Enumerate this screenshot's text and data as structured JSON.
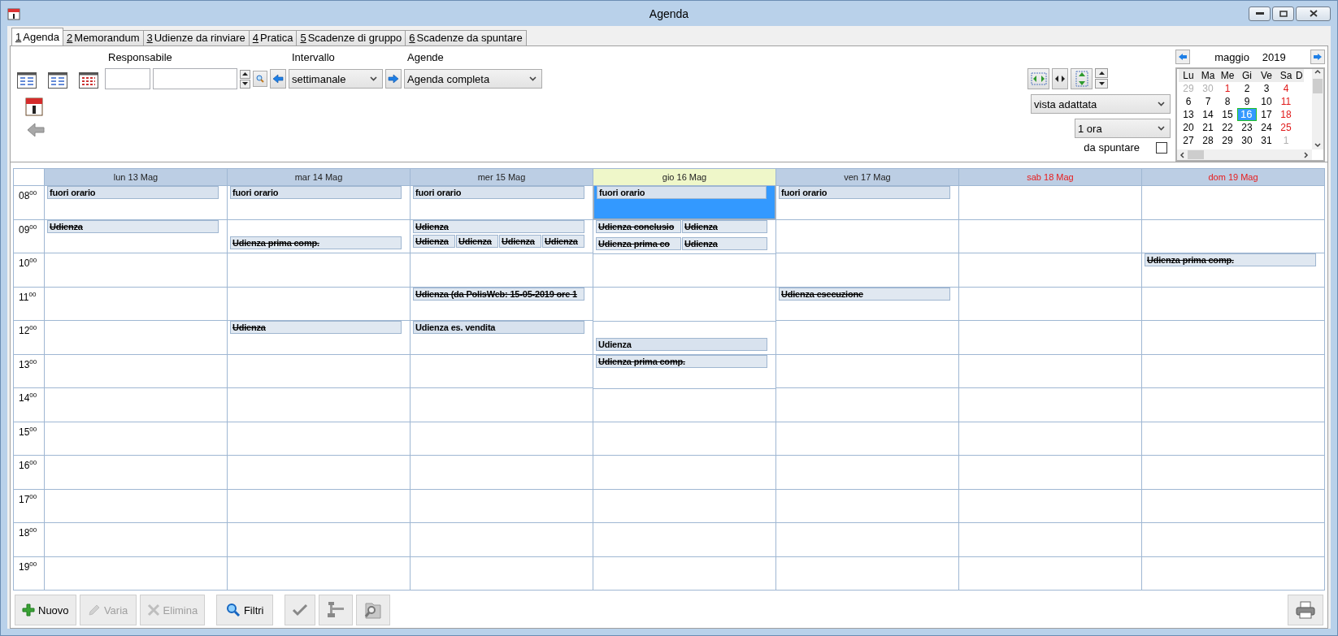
{
  "window": {
    "title": "Agenda"
  },
  "tabs": [
    {
      "key": "1",
      "label": "Agenda",
      "selected": true
    },
    {
      "key": "2",
      "label": "Memorandum",
      "selected": false
    },
    {
      "key": "3",
      "label": "Udienze da rinviare",
      "selected": false
    },
    {
      "key": "4",
      "label": "Pratica",
      "selected": false
    },
    {
      "key": "5",
      "label": "Scadenze di gruppo",
      "selected": false
    },
    {
      "key": "6",
      "label": "Scadenze da spuntare",
      "selected": false
    }
  ],
  "filters": {
    "responsabile": {
      "label": "Responsabile"
    },
    "intervallo": {
      "label": "Intervallo",
      "value": "settimanale"
    },
    "agende": {
      "label": "Agende",
      "value": "Agenda completa"
    }
  },
  "view": {
    "mode": "vista adattata",
    "step": "1 ora",
    "da_spuntare": {
      "label": "da spuntare",
      "checked": false
    }
  },
  "mini_calendar": {
    "month": "maggio",
    "year": "2019",
    "weekdays": [
      "Lu",
      "Ma",
      "Me",
      "Gi",
      "Ve",
      "Sa",
      "D"
    ],
    "weeks": [
      [
        {
          "day": "29",
          "kind": "muted",
          "selected": false
        },
        {
          "day": "30",
          "kind": "muted",
          "selected": false
        },
        {
          "day": "1",
          "kind": "red",
          "selected": false
        },
        {
          "day": "2",
          "kind": "normal",
          "selected": false
        },
        {
          "day": "3",
          "kind": "normal",
          "selected": false
        },
        {
          "day": "4",
          "kind": "red",
          "selected": false
        }
      ],
      [
        {
          "day": "6",
          "kind": "normal",
          "selected": false
        },
        {
          "day": "7",
          "kind": "normal",
          "selected": false
        },
        {
          "day": "8",
          "kind": "normal",
          "selected": false
        },
        {
          "day": "9",
          "kind": "normal",
          "selected": false
        },
        {
          "day": "10",
          "kind": "normal",
          "selected": false
        },
        {
          "day": "11",
          "kind": "red",
          "selected": false
        }
      ],
      [
        {
          "day": "13",
          "kind": "normal",
          "selected": false
        },
        {
          "day": "14",
          "kind": "normal",
          "selected": false
        },
        {
          "day": "15",
          "kind": "normal",
          "selected": false
        },
        {
          "day": "16",
          "kind": "normal",
          "selected": true
        },
        {
          "day": "17",
          "kind": "normal",
          "selected": false
        },
        {
          "day": "18",
          "kind": "red",
          "selected": false
        }
      ],
      [
        {
          "day": "20",
          "kind": "normal",
          "selected": false
        },
        {
          "day": "21",
          "kind": "normal",
          "selected": false
        },
        {
          "day": "22",
          "kind": "normal",
          "selected": false
        },
        {
          "day": "23",
          "kind": "normal",
          "selected": false
        },
        {
          "day": "24",
          "kind": "normal",
          "selected": false
        },
        {
          "day": "25",
          "kind": "red",
          "selected": false
        }
      ],
      [
        {
          "day": "27",
          "kind": "normal",
          "selected": false
        },
        {
          "day": "28",
          "kind": "normal",
          "selected": false
        },
        {
          "day": "29",
          "kind": "normal",
          "selected": false
        },
        {
          "day": "30",
          "kind": "normal",
          "selected": false
        },
        {
          "day": "31",
          "kind": "normal",
          "selected": false
        },
        {
          "day": "1",
          "kind": "muted",
          "selected": false
        }
      ]
    ]
  },
  "hours": [
    {
      "hour": "08",
      "minutes": "00"
    },
    {
      "hour": "09",
      "minutes": "00"
    },
    {
      "hour": "10",
      "minutes": "00"
    },
    {
      "hour": "11",
      "minutes": "00"
    },
    {
      "hour": "12",
      "minutes": "00"
    },
    {
      "hour": "13",
      "minutes": "00"
    },
    {
      "hour": "14",
      "minutes": "00"
    },
    {
      "hour": "15",
      "minutes": "00"
    },
    {
      "hour": "16",
      "minutes": "00"
    },
    {
      "hour": "17",
      "minutes": "00"
    },
    {
      "hour": "18",
      "minutes": "00"
    },
    {
      "hour": "19",
      "minutes": "00"
    }
  ],
  "days": [
    {
      "label": "lun 13 Mag",
      "today": false,
      "weekend": false,
      "slots": [
        {
          "selected": false,
          "top": [
            {
              "title": "fuori orario",
              "done": false
            }
          ]
        },
        {
          "selected": false,
          "top": [
            {
              "title": "Udienza",
              "done": true
            }
          ]
        },
        {
          "selected": false
        },
        {
          "selected": false
        },
        {
          "selected": false
        },
        {
          "selected": false
        },
        {
          "selected": false
        },
        {
          "selected": false
        },
        {
          "selected": false
        },
        {
          "selected": false
        },
        {
          "selected": false
        },
        {
          "selected": false
        }
      ]
    },
    {
      "label": "mar 14 Mag",
      "today": false,
      "weekend": false,
      "slots": [
        {
          "selected": false,
          "top": [
            {
              "title": "fuori orario",
              "done": false
            }
          ]
        },
        {
          "selected": false,
          "bottom": [
            {
              "title": "Udienza prima comp.",
              "done": true
            }
          ]
        },
        {
          "selected": false
        },
        {
          "selected": false
        },
        {
          "selected": false,
          "top": [
            {
              "title": "Udienza",
              "done": true
            }
          ]
        },
        {
          "selected": false
        },
        {
          "selected": false
        },
        {
          "selected": false
        },
        {
          "selected": false
        },
        {
          "selected": false
        },
        {
          "selected": false
        },
        {
          "selected": false
        }
      ]
    },
    {
      "label": "mer 15 Mag",
      "today": false,
      "weekend": false,
      "slots": [
        {
          "selected": false,
          "top": [
            {
              "title": "fuori orario",
              "done": false
            }
          ]
        },
        {
          "selected": false,
          "top": [
            {
              "title": "Udienza",
              "done": true
            }
          ],
          "bottom": [
            {
              "title": "Udienza",
              "done": true
            },
            {
              "title": "Udienza",
              "done": true
            },
            {
              "title": "Udienza",
              "done": true
            },
            {
              "title": "Udienza",
              "done": true
            }
          ]
        },
        {
          "selected": false
        },
        {
          "selected": false,
          "top": [
            {
              "title": "Udienza (da PolisWeb: 15-05-2019 ore 1",
              "done": true
            }
          ]
        },
        {
          "selected": false,
          "top": [
            {
              "title": "Udienza es. vendita",
              "done": false
            }
          ]
        },
        {
          "selected": false
        },
        {
          "selected": false
        },
        {
          "selected": false
        },
        {
          "selected": false
        },
        {
          "selected": false
        },
        {
          "selected": false
        },
        {
          "selected": false
        }
      ]
    },
    {
      "label": "gio 16 Mag",
      "today": true,
      "weekend": false,
      "slots": [
        {
          "selected": true,
          "top": [
            {
              "title": "fuori orario",
              "done": false
            }
          ]
        },
        {
          "selected": false,
          "top": [
            {
              "title": "Udienza conclusio",
              "done": true
            },
            {
              "title": "Udienza",
              "done": true
            }
          ],
          "bottom": [
            {
              "title": "Udienza prima co",
              "done": true
            },
            {
              "title": "Udienza",
              "done": true
            }
          ]
        },
        {
          "selected": false
        },
        {
          "selected": false
        },
        {
          "selected": false,
          "bottom": [
            {
              "title": "Udienza",
              "done": false
            }
          ]
        },
        {
          "selected": false,
          "top": [
            {
              "title": "Udienza prima comp.",
              "done": true
            }
          ]
        },
        {
          "selected": false
        },
        {
          "selected": false
        },
        {
          "selected": false
        },
        {
          "selected": false
        },
        {
          "selected": false
        },
        {
          "selected": false
        }
      ]
    },
    {
      "label": "ven 17 Mag",
      "today": false,
      "weekend": false,
      "slots": [
        {
          "selected": false,
          "top": [
            {
              "title": "fuori orario",
              "done": false
            }
          ]
        },
        {
          "selected": false
        },
        {
          "selected": false
        },
        {
          "selected": false,
          "top": [
            {
              "title": "Udienza esecuzione",
              "done": true
            }
          ]
        },
        {
          "selected": false
        },
        {
          "selected": false
        },
        {
          "selected": false
        },
        {
          "selected": false
        },
        {
          "selected": false
        },
        {
          "selected": false
        },
        {
          "selected": false
        },
        {
          "selected": false
        }
      ]
    },
    {
      "label": "sab 18 Mag",
      "today": false,
      "weekend": true,
      "slots": [
        {
          "selected": false
        },
        {
          "selected": false
        },
        {
          "selected": false
        },
        {
          "selected": false
        },
        {
          "selected": false
        },
        {
          "selected": false
        },
        {
          "selected": false
        },
        {
          "selected": false
        },
        {
          "selected": false
        },
        {
          "selected": false
        },
        {
          "selected": false
        },
        {
          "selected": false
        }
      ]
    },
    {
      "label": "dom 19 Mag",
      "today": false,
      "weekend": true,
      "slots": [
        {
          "selected": false
        },
        {
          "selected": false
        },
        {
          "selected": false,
          "top": [
            {
              "title": "Udienza prima comp.",
              "done": true
            }
          ]
        },
        {
          "selected": false
        },
        {
          "selected": false
        },
        {
          "selected": false
        },
        {
          "selected": false
        },
        {
          "selected": false
        },
        {
          "selected": false
        },
        {
          "selected": false
        },
        {
          "selected": false
        },
        {
          "selected": false
        }
      ]
    }
  ],
  "actions": [
    {
      "kind": "plus",
      "label": "Nuovo",
      "disabled": false
    },
    {
      "kind": "pencil",
      "label": "Varia",
      "disabled": true
    },
    {
      "kind": "cross",
      "label": "Elimina",
      "disabled": true
    },
    {
      "kind": "search",
      "label": "Filtri",
      "disabled": false
    },
    {
      "kind": "check",
      "disabled": false
    },
    {
      "kind": "gavel",
      "disabled": false
    },
    {
      "kind": "folder-search",
      "disabled": false
    },
    {
      "kind": "printer",
      "disabled": false
    }
  ]
}
